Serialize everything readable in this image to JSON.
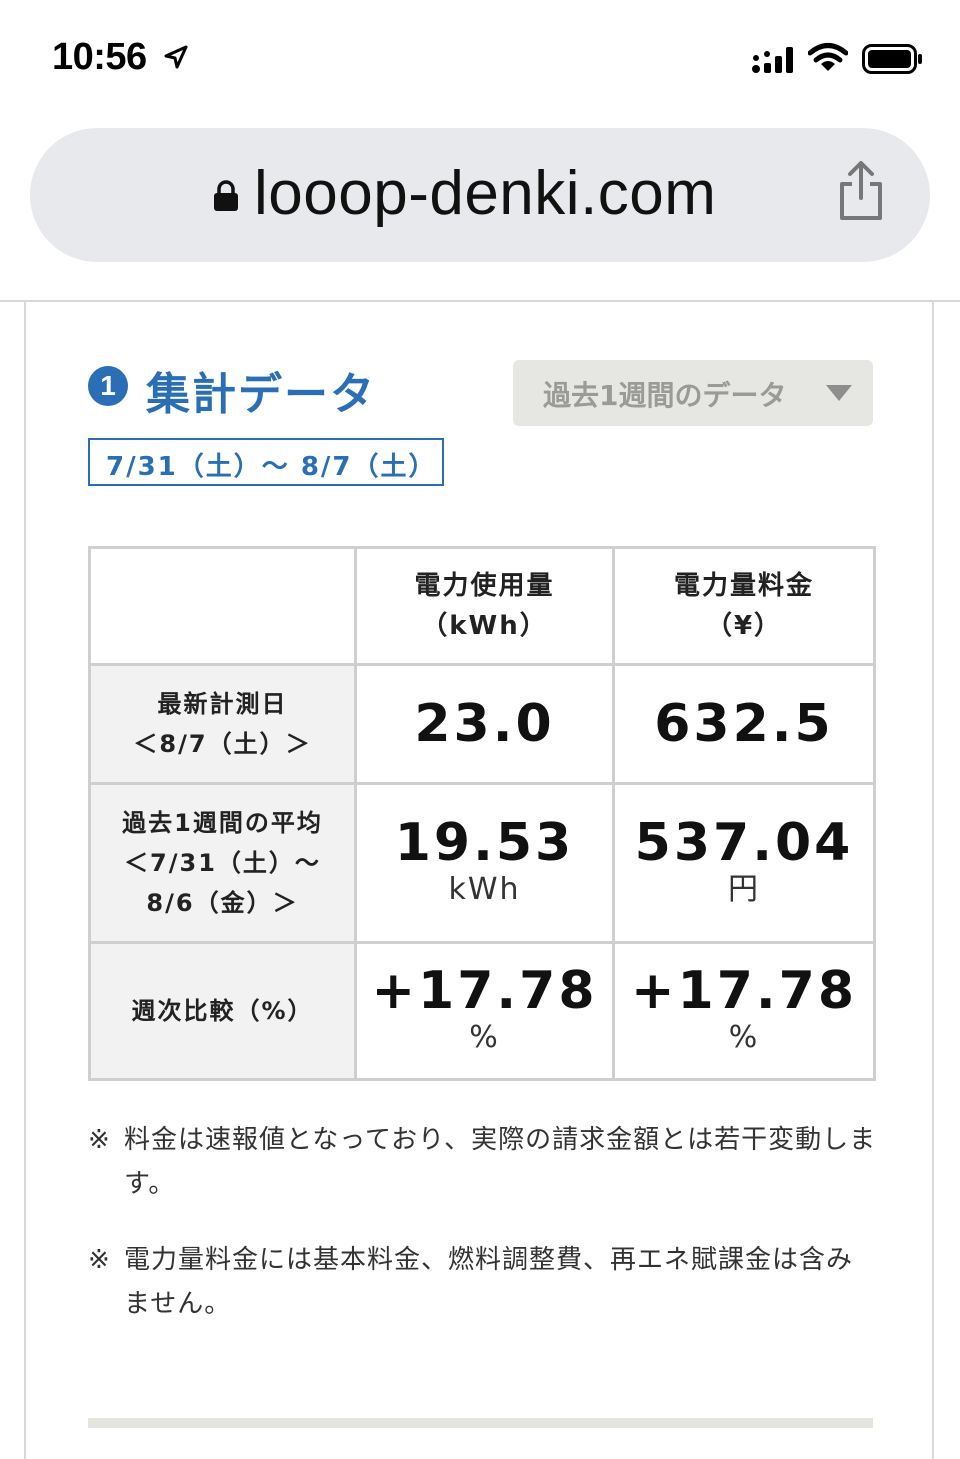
{
  "status_bar": {
    "time": "10:56",
    "icons": [
      "location-arrow-icon",
      "signal-icon",
      "wifi-icon",
      "battery-icon"
    ]
  },
  "browser": {
    "url": "looop-denki.com",
    "icons": [
      "lock-icon",
      "share-icon"
    ]
  },
  "section": {
    "number": "1",
    "title": "集計データ",
    "period_select": "過去1週間のデータ",
    "date_range": "7/31（土）～ 8/7（土）"
  },
  "table": {
    "headers": {
      "usage_line1": "電力使用量",
      "usage_line2": "（kWh）",
      "charge_line1": "電力量料金",
      "charge_line2": "（¥）"
    },
    "rows": [
      {
        "label_line1": "最新計測日",
        "label_line2": "＜8/7（土）＞",
        "label_line3": "",
        "usage": "23.0",
        "usage_unit": "",
        "charge": "632.5",
        "charge_unit": ""
      },
      {
        "label_line1": "過去1週間の平均",
        "label_line2": "＜7/31（土）～",
        "label_line3": "8/6（金）＞",
        "usage": "19.53",
        "usage_unit": "kWh",
        "charge": "537.04",
        "charge_unit": "円"
      },
      {
        "label_line1": "週次比較（%）",
        "label_line2": "",
        "label_line3": "",
        "usage": "+17.78",
        "usage_unit": "%",
        "charge": "+17.78",
        "charge_unit": "%"
      }
    ]
  },
  "notes": [
    {
      "mark": "※",
      "text": "料金は速報値となっており、実際の請求金額とは若干変動します。"
    },
    {
      "mark": "※",
      "text": "電力量料金には基本料金、燃料調整費、再エネ賦課金は含みません。"
    }
  ],
  "colors": {
    "accent": "#2a6fb5",
    "label_bg": "#f2f2f2",
    "select_bg": "#e6e6e3",
    "url_bar_bg": "#e8e9ec"
  }
}
